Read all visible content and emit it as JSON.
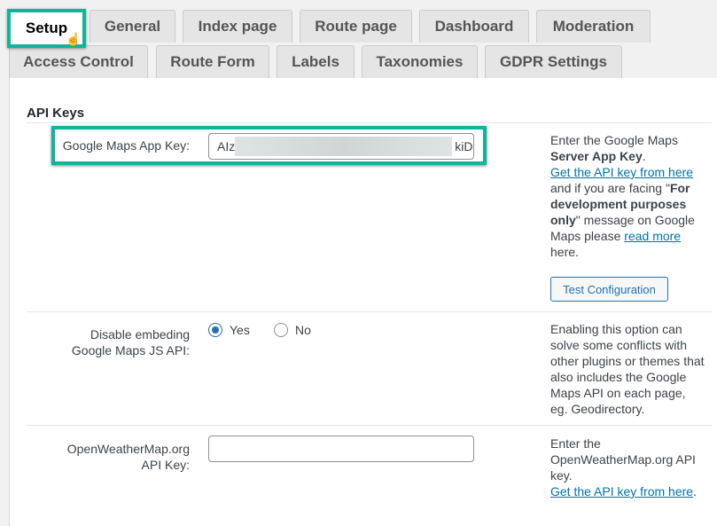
{
  "tabs_row1": [
    {
      "label": "Setup",
      "active": true
    },
    {
      "label": "General"
    },
    {
      "label": "Index page"
    },
    {
      "label": "Route page"
    },
    {
      "label": "Dashboard"
    },
    {
      "label": "Moderation"
    }
  ],
  "tabs_row2": [
    {
      "label": "Access Control"
    },
    {
      "label": "Route Form"
    },
    {
      "label": "Labels"
    },
    {
      "label": "Taxonomies"
    },
    {
      "label": "GDPR Settings"
    }
  ],
  "section_title": "API Keys",
  "google": {
    "label": "Google Maps App Key:",
    "value_start": "AIz",
    "value_end": "kiD",
    "desc1": "Enter the Google Maps",
    "desc_bold": "Server App Key",
    "desc_dot": ".",
    "link1": "Get the API key from here",
    "desc2": "and if you are facing \"",
    "desc_bold2": "For development purposes only",
    "desc3": "\" message on Google Maps please ",
    "link2": "read more",
    "desc4": " here.",
    "button": "Test Configuration"
  },
  "embed": {
    "label": "Disable embeding Google Maps JS API:",
    "yes": "Yes",
    "no": "No",
    "selected": "Yes",
    "desc": "Enabling this option can solve some conflicts with other plugins or themes that also includes the Google Maps API on each page, eg. Geodirectory."
  },
  "weather": {
    "label": "OpenWeatherMap.org API Key:",
    "value": "",
    "desc": "Enter the OpenWeatherMap.org API key.",
    "link": "Get the API key from here",
    "link_suffix": "."
  },
  "colors": {
    "highlight": "#0fb59b",
    "link": "#0073aa"
  }
}
